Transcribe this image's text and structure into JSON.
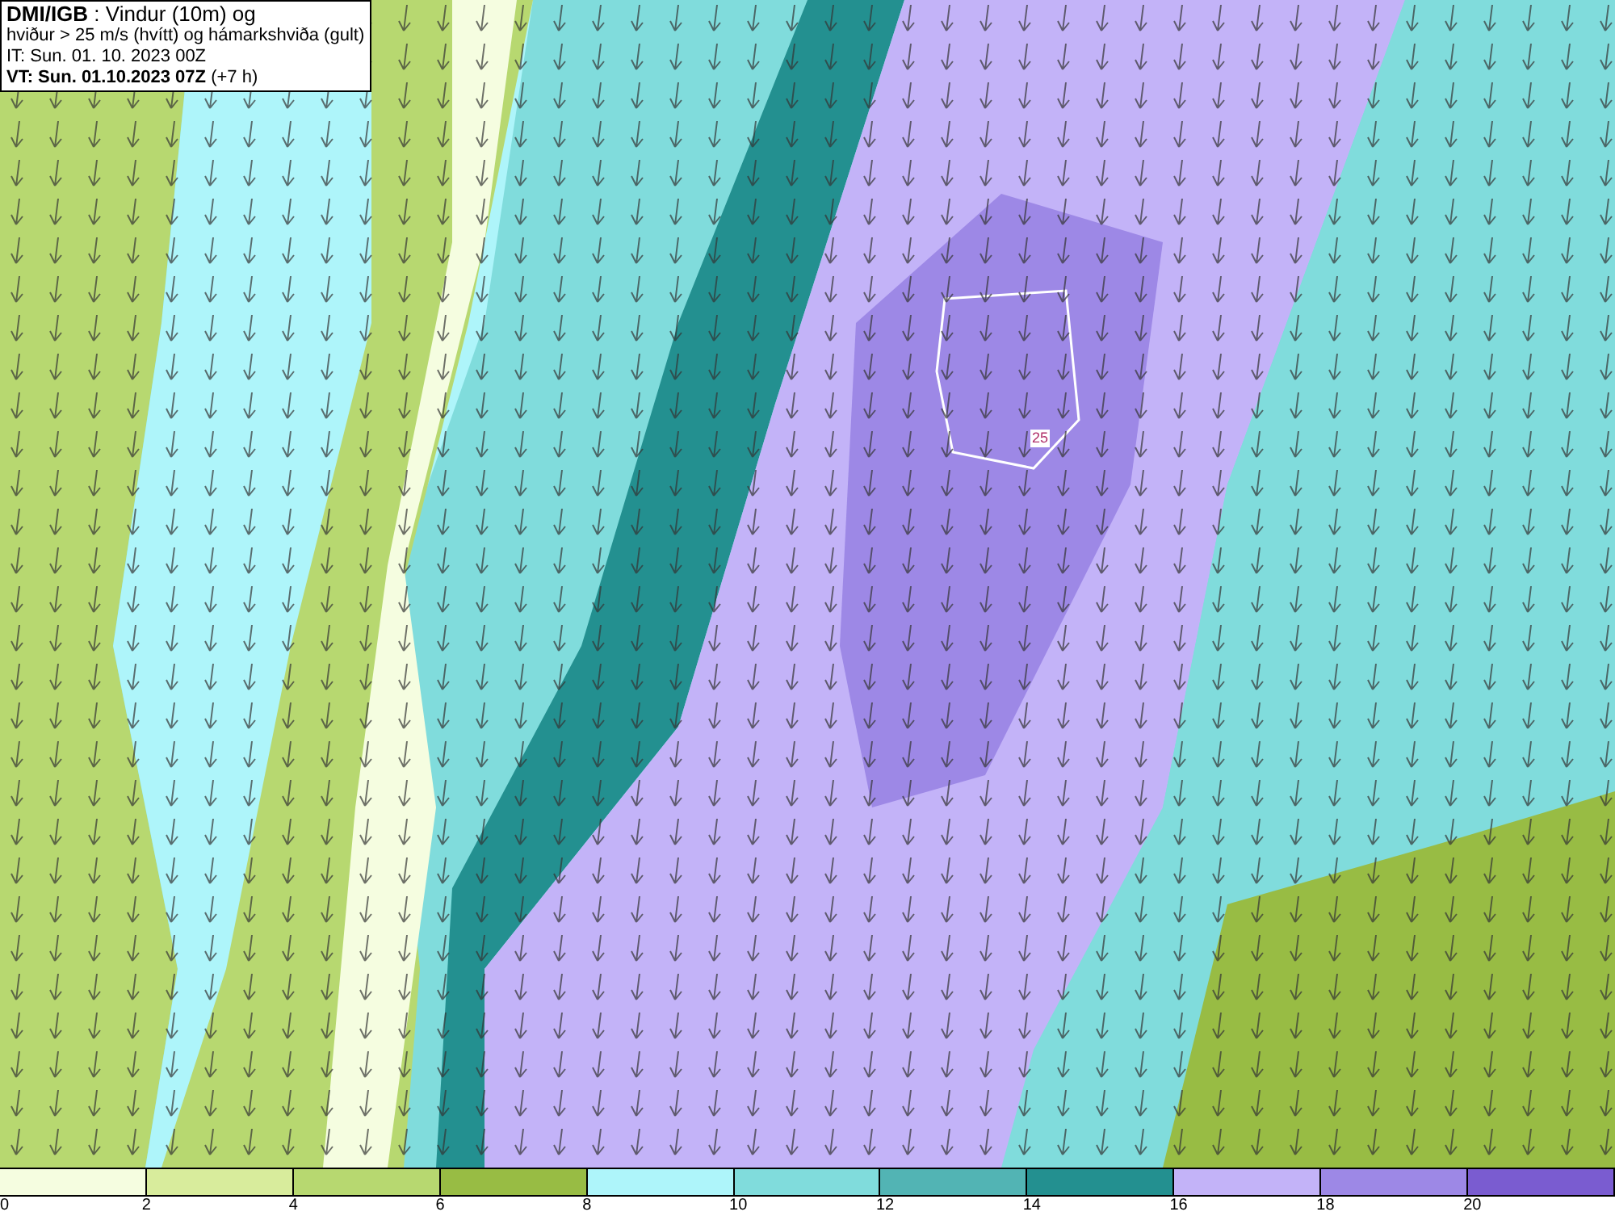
{
  "title_box": {
    "lines": [
      "**DMI/IGB** : Vindur (10m) og",
      "hviður > 25 m/s (hvítt) og hámarkshviða (gult)",
      "IT: Sun. 01. 10. 2023 00Z",
      "**VT: Sun. 01.10.2023 07Z** (+7 h)"
    ]
  },
  "map": {
    "contour_label": "25"
  },
  "colorbar": {
    "bins": [
      {
        "color": "#f5fde0",
        "tick": "0"
      },
      {
        "color": "#d8ec9c",
        "tick": "2"
      },
      {
        "color": "#b7d870",
        "tick": "4"
      },
      {
        "color": "#98bc44",
        "tick": "6"
      },
      {
        "color": "#aef5fa",
        "tick": "8"
      },
      {
        "color": "#80dcdc",
        "tick": "10"
      },
      {
        "color": "#52b4b4",
        "tick": "12"
      },
      {
        "color": "#239090",
        "tick": "14"
      },
      {
        "color": "#c3b3f8",
        "tick": "16"
      },
      {
        "color": "#9d88e6",
        "tick": "18"
      },
      {
        "color": "#7a5cd0",
        "tick": "20"
      }
    ]
  }
}
